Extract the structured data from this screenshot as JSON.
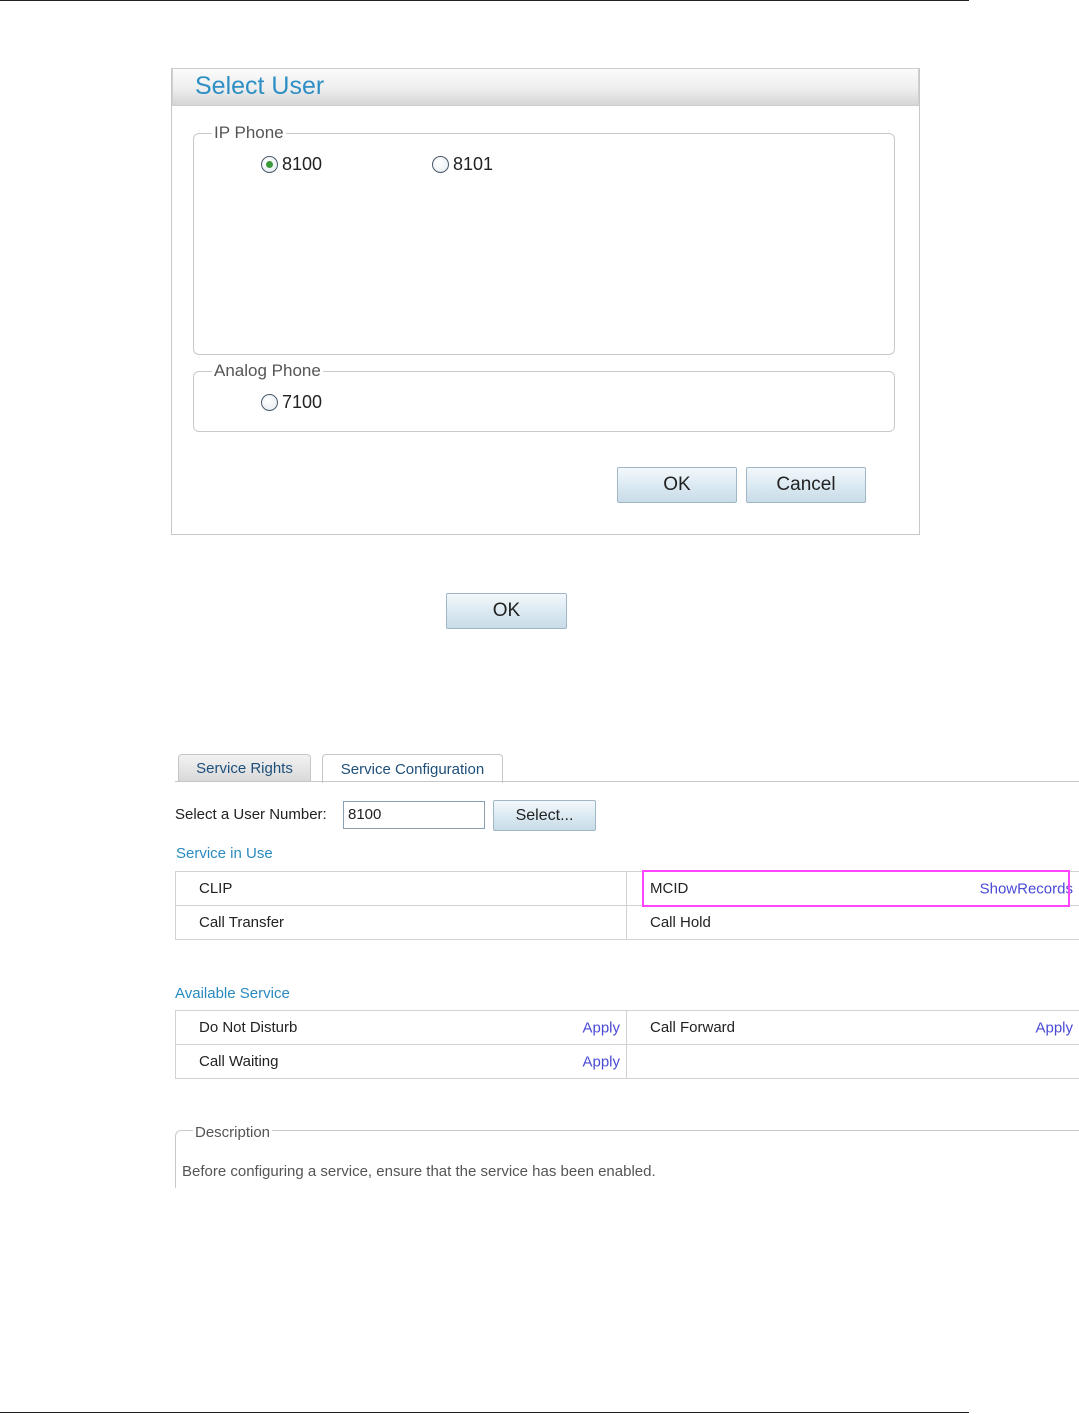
{
  "dialog": {
    "title": "Select User",
    "ip_phone": {
      "legend": "IP Phone",
      "options": [
        {
          "label": "8100",
          "checked": true
        },
        {
          "label": "8101",
          "checked": false
        }
      ]
    },
    "analog_phone": {
      "legend": "Analog Phone",
      "options": [
        {
          "label": "7100",
          "checked": false
        }
      ]
    },
    "ok_label": "OK",
    "cancel_label": "Cancel"
  },
  "standalone_ok_label": "OK",
  "service_config": {
    "tabs": [
      {
        "label": "Service Rights",
        "active": false
      },
      {
        "label": "Service Configuration",
        "active": true
      }
    ],
    "user_number_label": "Select a User Number:",
    "user_number_value": "8100",
    "select_button_label": "Select...",
    "service_in_use": {
      "title": "Service in Use",
      "rows": [
        [
          {
            "name": "CLIP"
          },
          {
            "name": "MCID",
            "link": "ShowRecords"
          }
        ],
        [
          {
            "name": "Call Transfer"
          },
          {
            "name": "Call Hold"
          }
        ]
      ]
    },
    "available_service": {
      "title": "Available Service",
      "rows": [
        [
          {
            "name": "Do Not Disturb",
            "action": "Apply"
          },
          {
            "name": "Call Forward",
            "action": "Apply"
          }
        ],
        [
          {
            "name": "Call Waiting",
            "action": "Apply"
          },
          {
            "name": ""
          }
        ]
      ]
    },
    "description": {
      "legend": "Description",
      "text": "Before configuring a service, ensure that the service has been enabled."
    }
  },
  "colors": {
    "title_blue": "#2e8fc4",
    "link_blue": "#4a4ad6",
    "highlight_magenta": "#ff44ff"
  }
}
